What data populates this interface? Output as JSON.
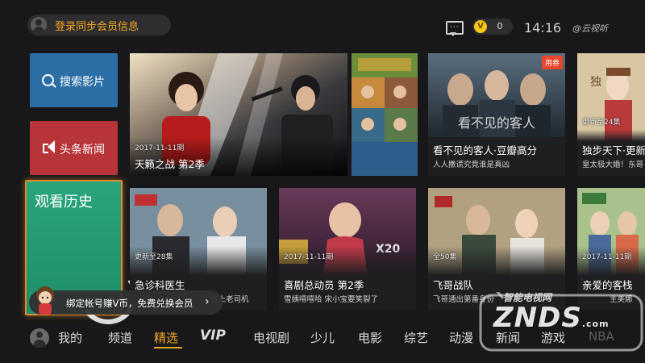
{
  "header": {
    "login_text": "登录同步会员信息",
    "coin_count": "0",
    "coin_symbol": "V",
    "clock": "14:16",
    "brand": "云视听"
  },
  "side_tiles": {
    "search_label": "搜索影片",
    "news_label": "头条新闻",
    "history_label": "观看历史"
  },
  "promo": {
    "text": "绑定帐号赚V币，免费兑换会员",
    "arrow": "›"
  },
  "cards_row1": [
    {
      "episode": "2017-11-11期",
      "title": "天籁之战 第2季",
      "subtitle": ""
    },
    {
      "episode": "",
      "title": "看不见的客人·豆瓣高分",
      "subtitle": "人人撒谎究竟谁是真凶",
      "badge": "用券"
    },
    {
      "episode": "更新至24集",
      "title": "独步天下·更新",
      "subtitle": "皇太极大婚！东哥"
    }
  ],
  "cards_row2": [
    {
      "episode": "更新至28集",
      "title": "急诊科医生",
      "subtitle": "遇上老司机"
    },
    {
      "episode": "2017-11-11期",
      "title": "喜剧总动员 第2季",
      "subtitle": "雪姨嘻嘻哈 宋小宝要笑裂了"
    },
    {
      "episode": "全50集",
      "title": "飞哥战队",
      "subtitle": "飞哥通出第番身份"
    },
    {
      "episode": "2017-11-11期",
      "title": "亲爱的客栈",
      "subtitle": "主美娜"
    }
  ],
  "nav": {
    "items": [
      "我的",
      "频道",
      "精选",
      "VIP",
      "电视剧",
      "少儿",
      "电影",
      "综艺",
      "动漫",
      "新闻",
      "游戏",
      "NBA"
    ],
    "active": "精选"
  },
  "watermark": {
    "cn": "智能电视网",
    "en": "ZNDS",
    "suffix": ".com"
  },
  "colors": {
    "accent": "#f5a623",
    "search_tile": "#2c6fa6",
    "news_tile": "#b73538",
    "history_tile": "#2aa57d",
    "focus_border": "#e08a2b",
    "badge": "#e8472b"
  }
}
